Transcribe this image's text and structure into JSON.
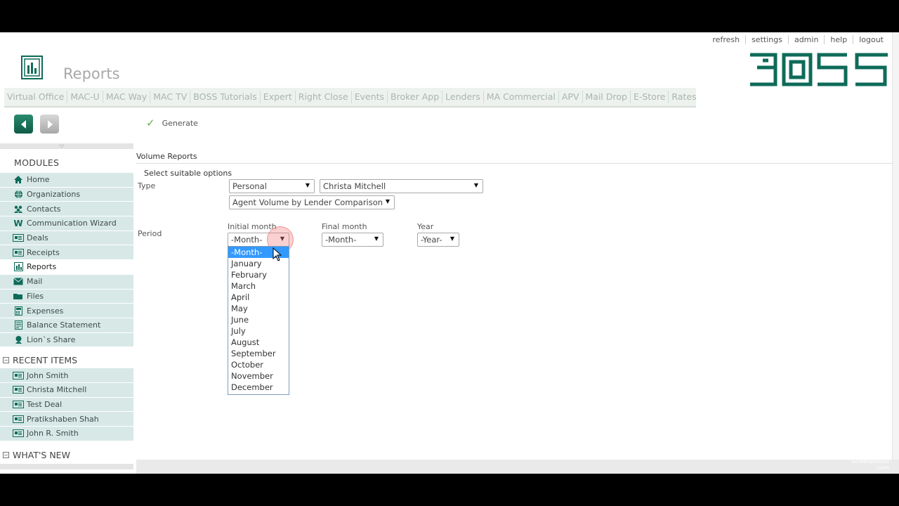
{
  "header": {
    "title": "Reports",
    "top_links": [
      "refresh",
      "settings",
      "admin",
      "help",
      "logout"
    ],
    "logo_text": "BOSS"
  },
  "menubar": [
    "Virtual Office",
    "MAC-U",
    "MAC Way",
    "MAC TV",
    "BOSS Tutorials",
    "Expert",
    "Right Close",
    "Events",
    "Broker App",
    "Lenders",
    "MA Commercial",
    "APV",
    "Mail Drop",
    "E-Store",
    "Rates"
  ],
  "toolbar": {
    "generate_label": "Generate"
  },
  "sidebar": {
    "modules_title": "MODULES",
    "modules": [
      {
        "label": "Home",
        "icon": "home-icon"
      },
      {
        "label": "Organizations",
        "icon": "globe-icon"
      },
      {
        "label": "Contacts",
        "icon": "contacts-icon"
      },
      {
        "label": "Communication Wizard",
        "icon": "wizard-w-icon"
      },
      {
        "label": "Deals",
        "icon": "card-icon"
      },
      {
        "label": "Receipts",
        "icon": "card-icon"
      },
      {
        "label": "Reports",
        "icon": "report-icon"
      },
      {
        "label": "Mail",
        "icon": "mail-icon"
      },
      {
        "label": "Files",
        "icon": "folder-icon"
      },
      {
        "label": "Expenses",
        "icon": "calculator-icon"
      },
      {
        "label": "Balance Statement",
        "icon": "statement-icon"
      },
      {
        "label": "Lion`s Share",
        "icon": "lion-icon"
      }
    ],
    "recent_title": "RECENT ITEMS",
    "recent": [
      "John Smith",
      "Christa Mitchell",
      "Test Deal",
      "Pratikshaben Shah",
      "John R. Smith"
    ],
    "whats_new_title": "WHAT'S NEW"
  },
  "main": {
    "heading": "Volume Reports",
    "options_title": "Select suitable options",
    "type_label": "Type",
    "type_value": "Personal",
    "agent_value": "Christa Mitchell",
    "report_value": "Agent Volume by Lender Comparison",
    "period_label": "Period",
    "initial_month_label": "Initial month",
    "initial_month_value": "-Month-",
    "final_month_label": "Final month",
    "final_month_value": "-Month-",
    "year_label": "Year",
    "year_value": "-Year-",
    "month_options": [
      "-Month-",
      "January",
      "February",
      "March",
      "April",
      "May",
      "June",
      "July",
      "August",
      "September",
      "October",
      "November",
      "December"
    ]
  },
  "watermark": {
    "line1": "Screenpresso",
    "line2": ".com"
  },
  "colors": {
    "brand": "#0e6b59",
    "sidebar_bg": "#d7e8e7",
    "selected_option": "#3399ff"
  }
}
